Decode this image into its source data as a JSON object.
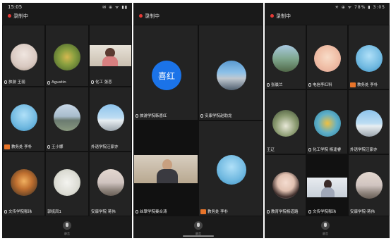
{
  "phone1": {
    "status_time": "15:05",
    "status_icons": "✉ ⊕ ᯤ ▮▮",
    "recording": "录制中",
    "tiles": [
      {
        "name": "旅游 王丽",
        "mic": true
      },
      {
        "name": "Agustin",
        "mic": true
      },
      {
        "name": "化工 张恋",
        "mic": true
      },
      {
        "name": "教务处 李朴",
        "mic": false,
        "host": true
      },
      {
        "name": "王小娜",
        "mic": true
      },
      {
        "name": "外语学院汪家亦",
        "mic": false
      },
      {
        "name": "文传学院郁玮",
        "mic": true
      },
      {
        "name": "郭梳凤1",
        "mic": false
      },
      {
        "name": "安康学院 蒋伟",
        "mic": false
      }
    ],
    "mic_label": "静音"
  },
  "phone2": {
    "recording": "录制中",
    "tiles": [
      {
        "name": "旅游学院韩喜红",
        "mic": true,
        "avatar_text": "喜红"
      },
      {
        "name": "安康学院赵助龙",
        "mic": true
      },
      {
        "name": "丝翠学院秦合涛",
        "mic": true
      },
      {
        "name": "教务处 李朴",
        "mic": false,
        "host": true
      }
    ],
    "mic_label": "静音"
  },
  "phone3": {
    "status_icons": "☀ ⊕ ᯤ 78% ▮ 3:05",
    "recording": "录制中",
    "tiles": [
      {
        "name": "张晨兰",
        "mic": true
      },
      {
        "name": "电信李红科",
        "mic": true
      },
      {
        "name": "教务处 李朴",
        "mic": false,
        "host": true
      },
      {
        "name": "王辽",
        "mic": false
      },
      {
        "name": "化工学院 杨逢睿",
        "mic": true
      },
      {
        "name": "外语学院汪家亦",
        "mic": false
      },
      {
        "name": "教育学院杨道路",
        "mic": true
      },
      {
        "name": "文传学院郁玮",
        "mic": true
      },
      {
        "name": "安康学院-蒋伟",
        "mic": false
      }
    ],
    "mic_label": "静音"
  }
}
